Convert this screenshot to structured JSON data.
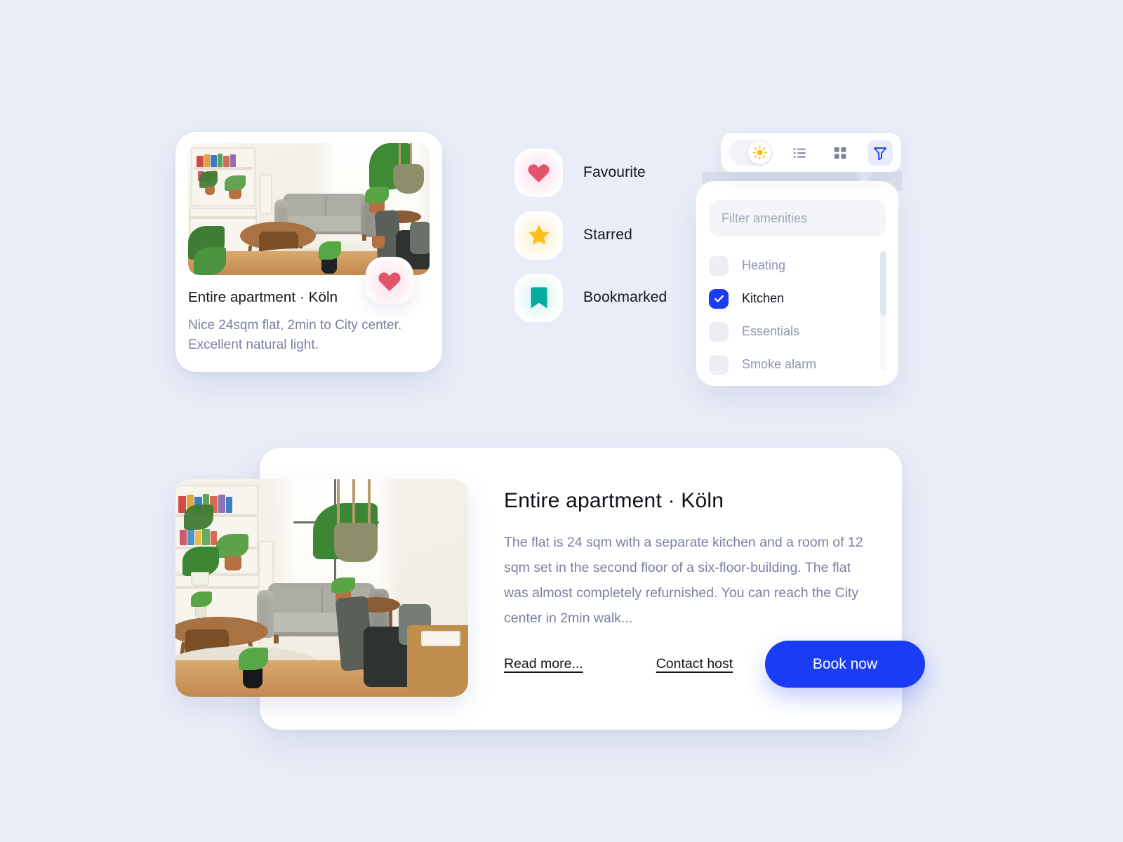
{
  "theme": {
    "background": "#e9edf7",
    "accent_blue": "#1a3cf5",
    "heart_red": "#e0556c",
    "star_yellow": "#fcbf1e",
    "bookmark_teal": "#04aba0",
    "card_white": "#ffffff",
    "muted_text": "#7b80a3"
  },
  "property_card": {
    "title": "Entire apartment · Köln",
    "description": "Nice 24sqm flat, 2min to City center. Excellent natural light.",
    "favourite_icon": "heart-icon",
    "image_alt": "apartment-living-room-photo"
  },
  "status_list": {
    "items": [
      {
        "label": "Favourite",
        "icon": "heart-icon",
        "color": "#e0556c"
      },
      {
        "label": "Starred",
        "icon": "star-icon",
        "color": "#fcbf1e"
      },
      {
        "label": "Bookmarked",
        "icon": "bookmark-icon",
        "color": "#04aba0"
      }
    ]
  },
  "toolbar": {
    "theme_toggle": {
      "icon": "sun-icon",
      "state": "light"
    },
    "buttons": [
      {
        "icon": "list-view-icon",
        "active": false
      },
      {
        "icon": "grid-view-icon",
        "active": false
      },
      {
        "icon": "filter-icon",
        "active": true
      }
    ]
  },
  "filter_panel": {
    "search": {
      "placeholder": "Filter amenities",
      "value": ""
    },
    "amenities": [
      {
        "label": "Heating",
        "checked": false
      },
      {
        "label": "Kitchen",
        "checked": true
      },
      {
        "label": "Essentials",
        "checked": false
      },
      {
        "label": "Smoke alarm",
        "checked": false
      }
    ],
    "scrollbar": {
      "visible": true
    }
  },
  "detail_card": {
    "title": "Entire apartment · Köln",
    "description": "The flat is 24 sqm with a separate kitchen and a room of 12 sqm set in the second floor of a six-floor-building. The flat was almost completely refurnished. You can reach the City center in 2min walk...",
    "read_more_label": "Read more...",
    "contact_host_label": "Contact host",
    "book_button_label": "Book now",
    "image_alt": "apartment-living-room-photo-large"
  }
}
